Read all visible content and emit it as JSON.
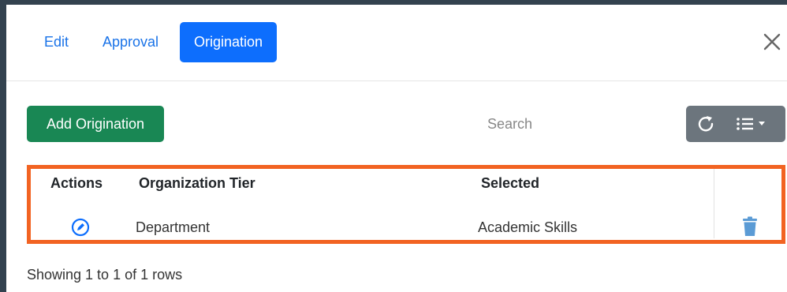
{
  "tabs": [
    {
      "label": "Edit",
      "active": false
    },
    {
      "label": "Approval",
      "active": false
    },
    {
      "label": "Origination",
      "active": true
    }
  ],
  "toolbar": {
    "add_label": "Add Origination",
    "search_placeholder": "Search"
  },
  "table": {
    "columns": [
      "Actions",
      "Organization Tier",
      "Selected"
    ],
    "rows": [
      {
        "organization_tier": "Department",
        "selected": "Academic Skills"
      }
    ]
  },
  "footer": {
    "status": "Showing 1 to 1 of 1 rows"
  },
  "colors": {
    "primary": "#0d6efd",
    "success": "#198754",
    "secondary": "#6c757d",
    "highlight": "#f26322"
  },
  "icons": [
    "close-icon",
    "refresh-icon",
    "columns-list-icon",
    "edit-icon",
    "trash-icon"
  ]
}
